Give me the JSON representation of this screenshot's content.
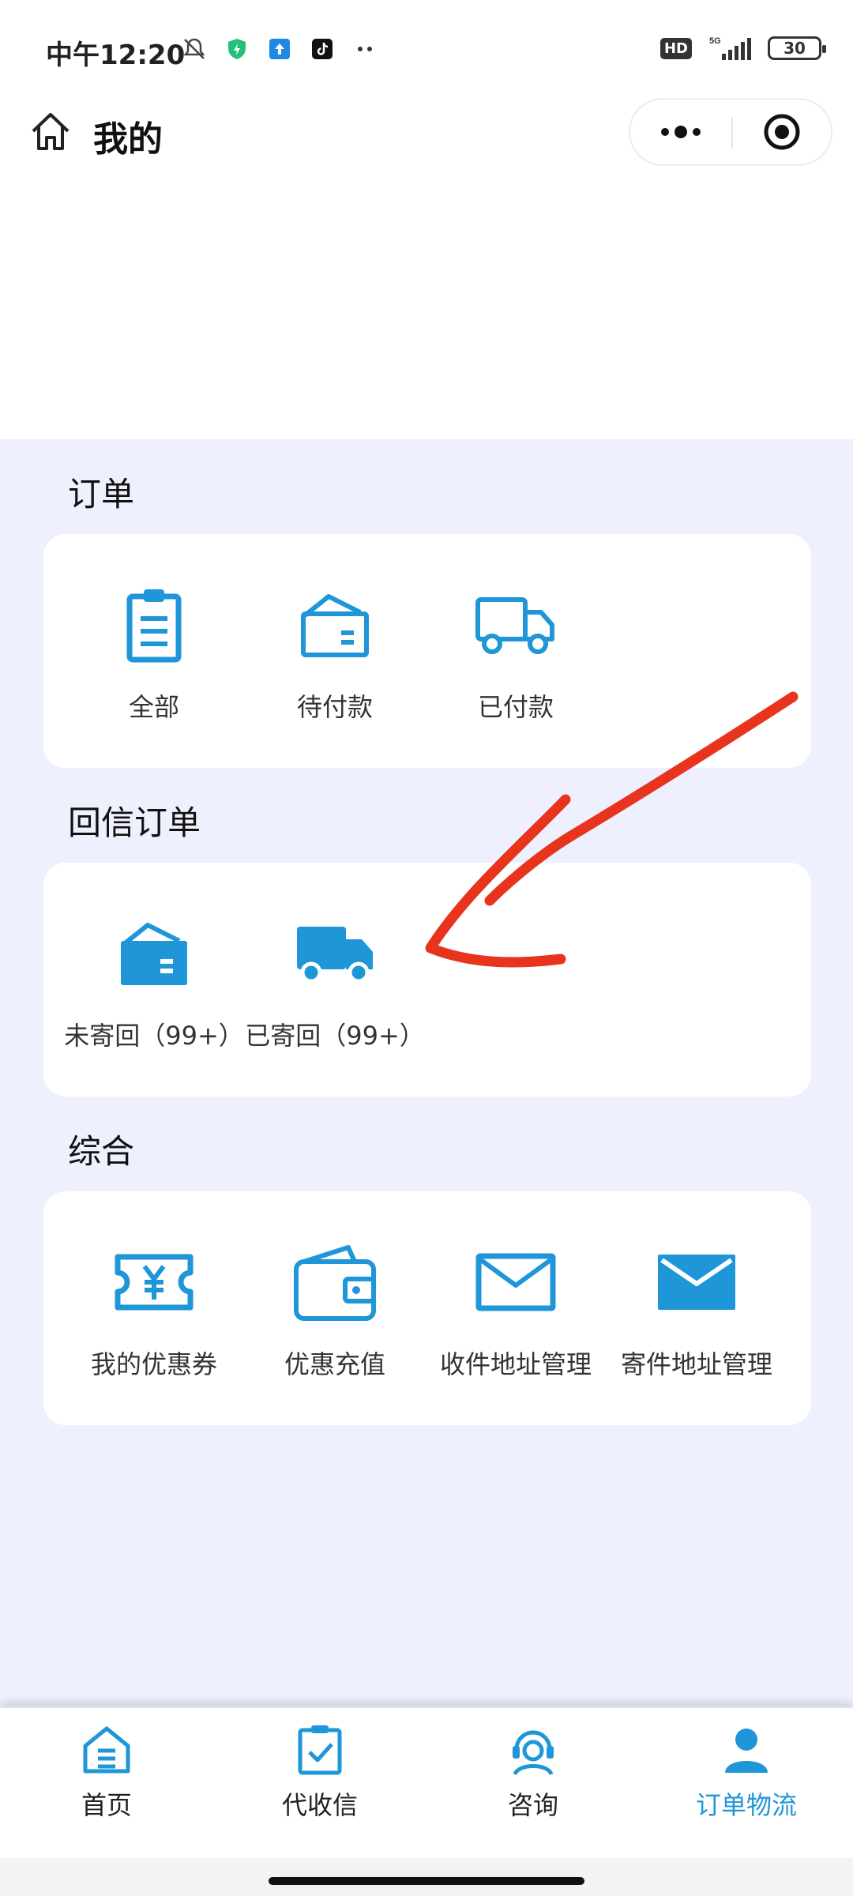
{
  "status_bar": {
    "time": "中午12:20",
    "network": "5G",
    "hd": "HD",
    "battery": "30"
  },
  "header": {
    "title": "我的"
  },
  "sections": {
    "orders": {
      "title": "订单",
      "items": [
        {
          "label": "全部",
          "icon": "clipboard-icon"
        },
        {
          "label": "待付款",
          "icon": "wallet-outline-icon"
        },
        {
          "label": "已付款",
          "icon": "truck-outline-icon"
        }
      ]
    },
    "reply_orders": {
      "title": "回信订单",
      "items": [
        {
          "label": "未寄回（99+）",
          "icon": "wallet-filled-icon"
        },
        {
          "label": "已寄回（99+）",
          "icon": "truck-filled-icon"
        }
      ]
    },
    "general": {
      "title": "综合",
      "items": [
        {
          "label": "我的优惠券",
          "icon": "coupon-icon"
        },
        {
          "label": "优惠充值",
          "icon": "wallet-icon"
        },
        {
          "label": "收件地址管理",
          "icon": "envelope-outline-icon"
        },
        {
          "label": "寄件地址管理",
          "icon": "envelope-filled-icon"
        }
      ]
    }
  },
  "tabbar": {
    "tabs": [
      {
        "label": "首页",
        "icon": "home-icon",
        "active": false
      },
      {
        "label": "代收信",
        "icon": "clipboard-check-icon",
        "active": false
      },
      {
        "label": "咨询",
        "icon": "headset-icon",
        "active": false
      },
      {
        "label": "订单物流",
        "icon": "user-icon",
        "active": true
      }
    ]
  },
  "colors": {
    "accent": "#1e96d8",
    "background": "#eef0fd",
    "annotation": "#e8341c"
  }
}
